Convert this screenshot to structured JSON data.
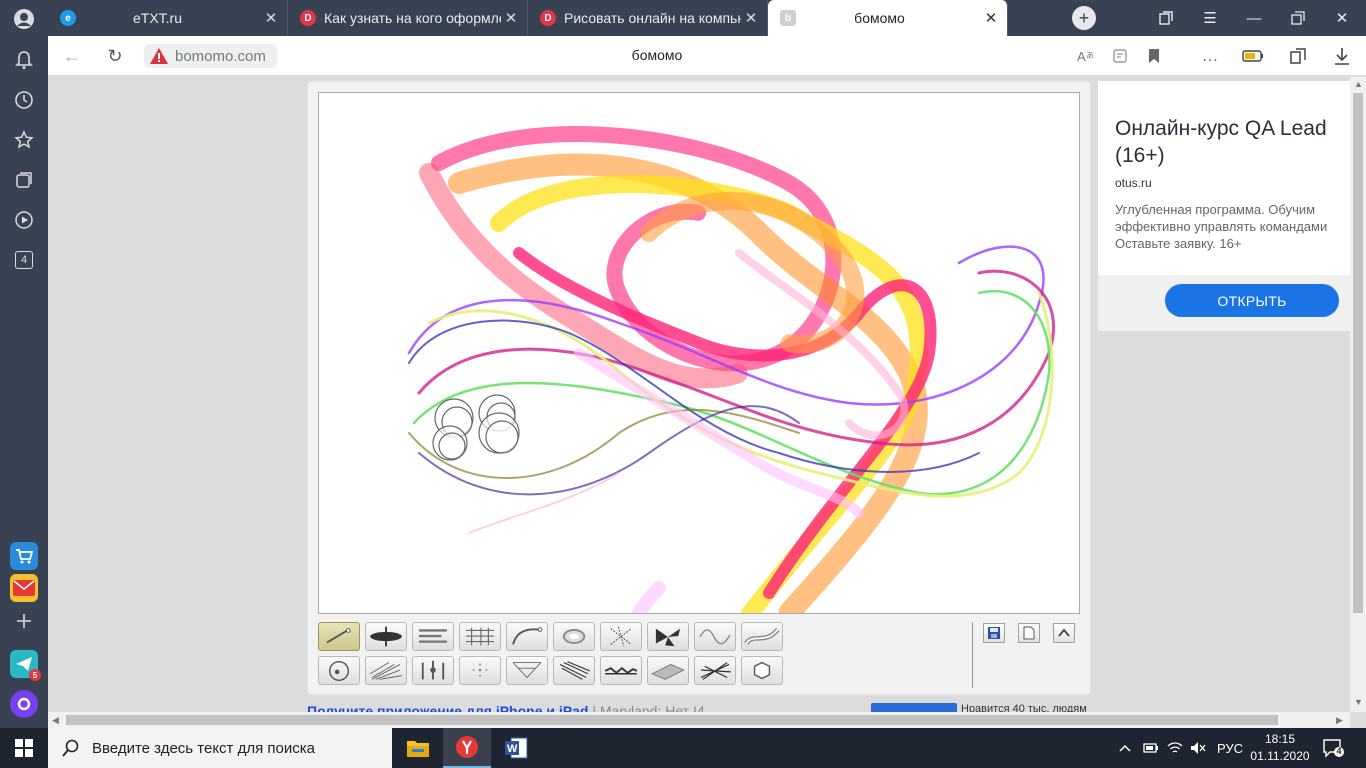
{
  "tabs": [
    {
      "title": "eTXT.ru",
      "favicon_color": "#1e9be8",
      "favicon_icon": "etxt-icon"
    },
    {
      "title": "Как узнать на кого оформле",
      "favicon_color": "#e8334a",
      "favicon_icon": "dzen-icon"
    },
    {
      "title": "Рисовать онлайн на компью",
      "favicon_color": "#e8334a",
      "favicon_icon": "dzen-icon"
    },
    {
      "title": "бомомо",
      "favicon_color": "#bbbbbb",
      "favicon_icon": "bomomo-icon",
      "active": true
    }
  ],
  "address_bar": {
    "url": "bomomo.com",
    "page_title": "бомомо",
    "security": "warning-icon"
  },
  "side_panel": {
    "tab_count": "4",
    "messenger_badge": "5"
  },
  "drawing_tools": {
    "row1": [
      "line-brush",
      "ellipse-brush",
      "bars-brush",
      "grid-brush",
      "curve-brush",
      "ring-brush",
      "scatter-brush",
      "fan-brush",
      "wave-brush",
      "ribbon-brush"
    ],
    "row2": [
      "circle-brush",
      "hatch-brush",
      "pins-brush",
      "dots-brush",
      "web-brush",
      "spray-brush",
      "zigzag-brush",
      "fold-brush",
      "cross-brush",
      "hex-brush"
    ],
    "selected": "line-brush",
    "side_buttons": [
      "save-icon",
      "new-page-icon",
      "collapse-icon"
    ]
  },
  "ad": {
    "title": "Онлайн-курс QA Lead (16+)",
    "domain": "otus.ru",
    "text_lines": [
      "Углубленная программа. Обучим",
      "эффективно управлять командами",
      "Оставьте заявку. 16+"
    ],
    "button": "ОТКРЫТЬ"
  },
  "bottom": {
    "link_text": "Получите приложение для iPhone и iPad",
    "extra_text": " | Maryland: Нет I4",
    "likes_text": "Нравится 40 тыс. людям"
  },
  "taskbar": {
    "search_placeholder": "Введите здесь текст для поиска",
    "language": "РУС",
    "time": "18:15",
    "date": "01.11.2020",
    "notifications": "4"
  },
  "colors": {
    "accent_button": "#1a74e6",
    "tabbar": "#394252",
    "taskbar": "#1f2530"
  }
}
